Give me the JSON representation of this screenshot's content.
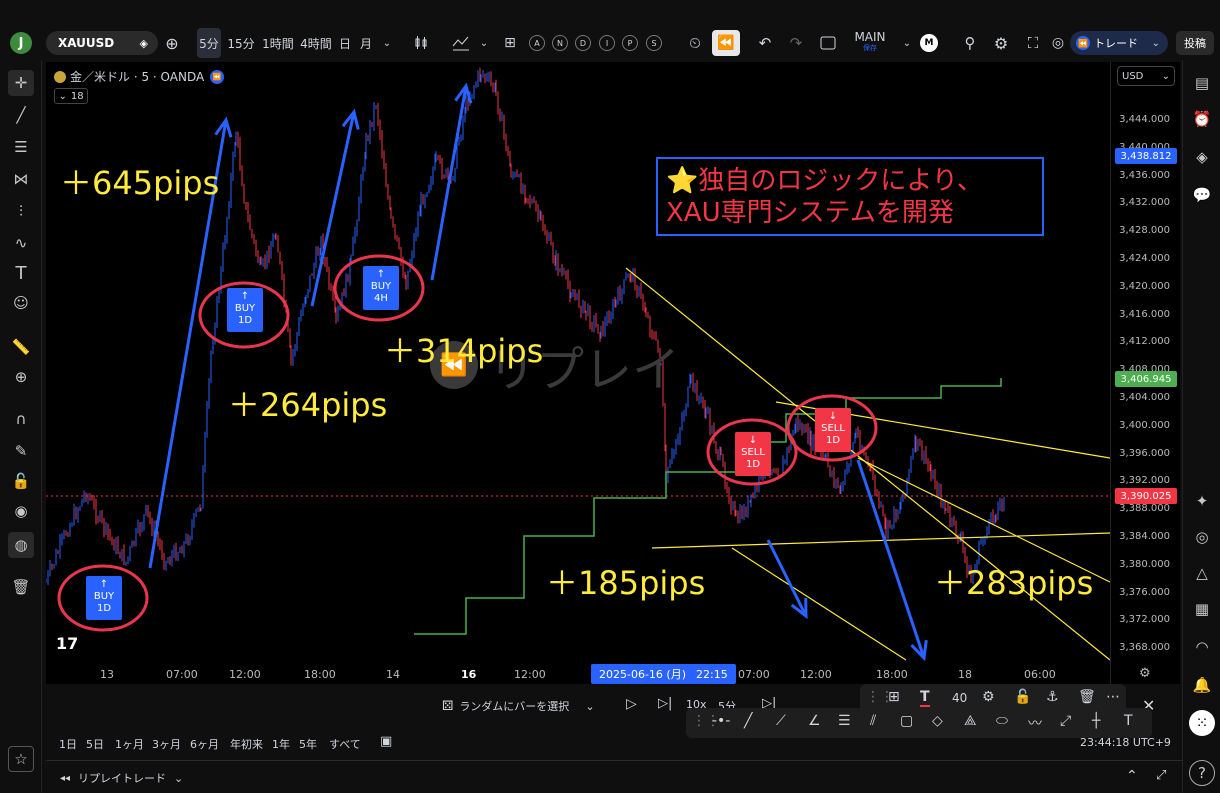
{
  "header": {
    "avatar_letter": "J",
    "symbol": "XAUUSD",
    "timeframes": [
      "5分",
      "15分",
      "1時間",
      "4時間",
      "日",
      "月"
    ],
    "indicator_circles": [
      "A",
      "N",
      "D",
      "I",
      "P",
      "S"
    ],
    "layout_name": "MAIN",
    "layout_sub": "保存",
    "layout_badge": "M",
    "trade_label": "トレード",
    "post_label": "投稿"
  },
  "chart": {
    "title": "金／米ドル · 5 · OANDA",
    "indicator_count": "18",
    "currency": "USD",
    "watermark": "リプレイ",
    "colors": {
      "up": "#2962ff",
      "down": "#f23645",
      "trend": "#ffeb3b",
      "step": "#4caf50",
      "price": "#f23645"
    },
    "annotations": {
      "p645": "＋645pips",
      "p264": "＋264pips",
      "p314": "＋314pips",
      "p185": "＋185pips",
      "p283": "＋283pips"
    },
    "signals": [
      {
        "arrow": "↑",
        "side": "BUY",
        "tf": "1D"
      },
      {
        "arrow": "↑",
        "side": "BUY",
        "tf": "1D"
      },
      {
        "arrow": "↑",
        "side": "BUY",
        "tf": "4H"
      },
      {
        "arrow": "↓",
        "side": "SELL",
        "tf": "1D"
      },
      {
        "arrow": "↓",
        "side": "SELL",
        "tf": "1D"
      }
    ],
    "logic_text_line1": "⭐独自のロジックにより、",
    "logic_text_line2": "XAU専門システムを開発"
  },
  "price_axis": {
    "labels": [
      "3,444.000",
      "3,440.000",
      "3,436.000",
      "3,432.000",
      "3,428.000",
      "3,424.000",
      "3,420.000",
      "3,416.000",
      "3,412.000",
      "3,408.000",
      "3,404.000",
      "3,400.000",
      "3,396.000",
      "3,392.000",
      "3,388.000",
      "3,384.000",
      "3,380.000",
      "3,376.000",
      "3,372.000",
      "3,368.000"
    ],
    "tag_blue": "3,438.812",
    "tag_green": "3,406.945",
    "tag_red": "3,390.025"
  },
  "time_axis": {
    "labels": [
      "13",
      "07:00",
      "12:00",
      "18:00",
      "14",
      "16",
      "12:00",
      "07:00",
      "12:00",
      "18:00",
      "18",
      "06:00"
    ],
    "cursor_date": "2025-06-16 (月)",
    "cursor_time": "22:15"
  },
  "bottom": {
    "random_bar": "ランダムにバーを選択",
    "speed": "10x",
    "interval": "5分",
    "ranges": [
      "1日",
      "5日",
      "1ヶ月",
      "3ヶ月",
      "6ヶ月",
      "年初来",
      "1年",
      "5年",
      "すべて"
    ],
    "clock": "23:44:18 UTC+9",
    "replay_label": "リプレイトレード",
    "font_size": "40"
  }
}
